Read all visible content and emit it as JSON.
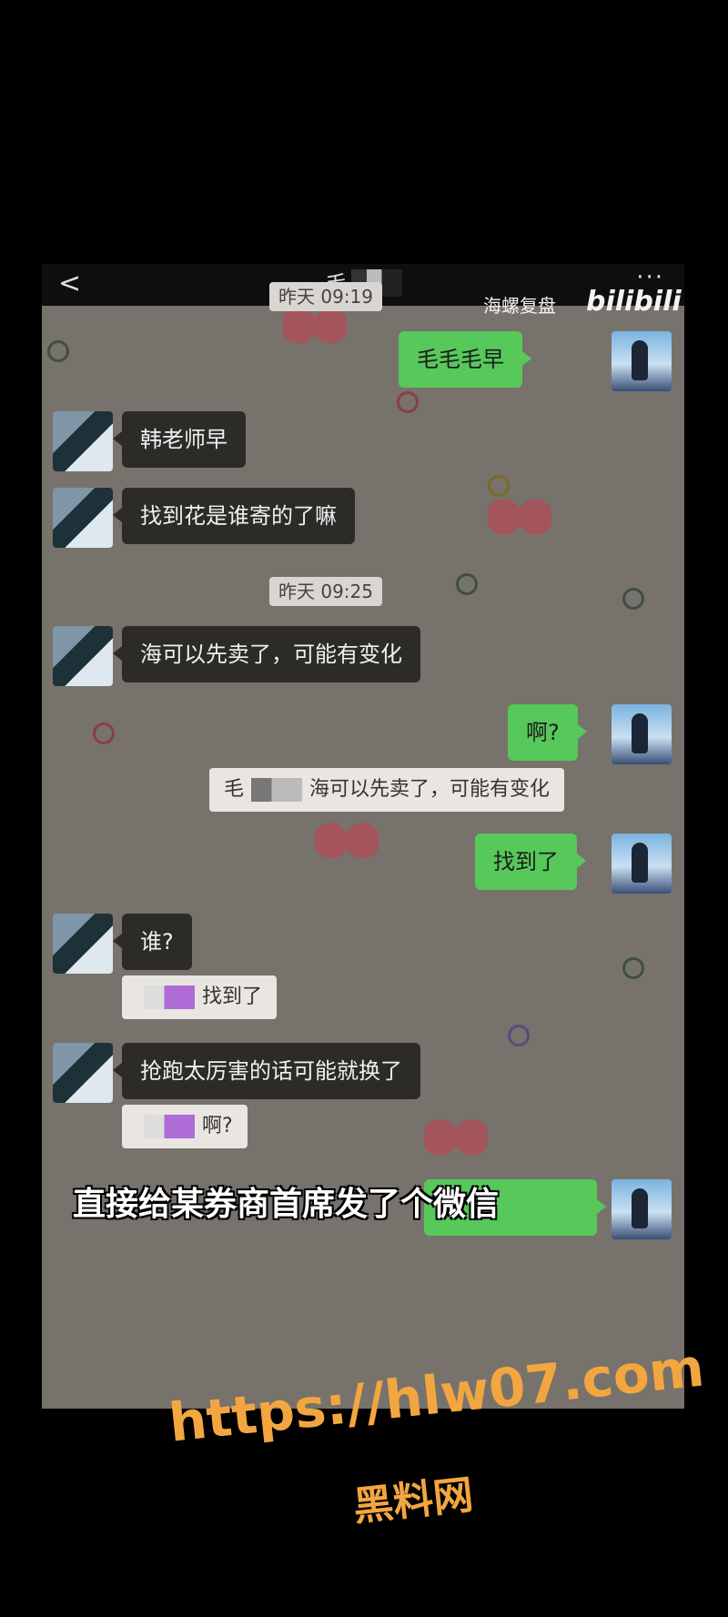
{
  "header": {
    "back_glyph": "<",
    "title": "毛",
    "more_glyph": "···",
    "watermark_text": "海螺复盘",
    "watermark_logo": "bilibili"
  },
  "messages": [
    {
      "kind": "timestamp",
      "text": "昨天 09:19"
    },
    {
      "kind": "right",
      "text": "毛毛毛早"
    },
    {
      "kind": "left",
      "text": "韩老师早"
    },
    {
      "kind": "left",
      "text": "找到花是谁寄的了嘛"
    },
    {
      "kind": "timestamp",
      "text": "昨天 09:25"
    },
    {
      "kind": "left",
      "text": "海可以先卖了，可能有变化"
    },
    {
      "kind": "right",
      "text": "啊?"
    },
    {
      "kind": "quote",
      "prefix": "毛",
      "text": "海可以先卖了，可能有变化"
    },
    {
      "kind": "right",
      "text": "找到了"
    },
    {
      "kind": "left",
      "text": "谁?"
    },
    {
      "kind": "quote",
      "prefix": "",
      "text": "找到了"
    },
    {
      "kind": "left",
      "text": "抢跑太厉害的话可能就换了"
    },
    {
      "kind": "quote",
      "prefix": "",
      "text": "啊?"
    }
  ],
  "caption": "直接给某券商首席发了个微信",
  "footer": {
    "url": "https://hlw07.com",
    "site_name": "黑料网"
  },
  "colors": {
    "background": "#000000",
    "chat_bg": "#77726c",
    "bubble_left": "#2d2b28",
    "bubble_right": "#57c85a",
    "watermark_url": "#f3a640"
  }
}
